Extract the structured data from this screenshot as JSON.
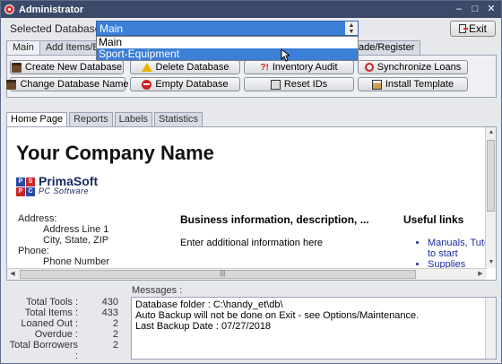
{
  "window": {
    "title": "Administrator",
    "controls": [
      "–",
      "□",
      "✕"
    ]
  },
  "database": {
    "label": "Selected Database :",
    "selected": "Main",
    "options": [
      "Main",
      "Sport-Equipment"
    ]
  },
  "exit_label": "Exit",
  "main_tabs": [
    "Main",
    "Add Items/B",
    "ade/Register"
  ],
  "toolbar": {
    "create_db": "Create New Database",
    "change_db_name": "Change Database Name",
    "delete_db": "Delete Database",
    "empty_db": "Empty Database",
    "inventory_audit": "Inventory Audit",
    "reset_ids": "Reset IDs",
    "sync_loans": "Synchronize Loans",
    "install_template": "Install Template"
  },
  "home_tabs": [
    "Home Page",
    "Reports",
    "Labels",
    "Statistics"
  ],
  "home_page": {
    "company_name": "Your Company Name",
    "logo_letters": [
      "P",
      "S",
      "P",
      "C"
    ],
    "logo_name": "PrimaSoft",
    "logo_sub": "PC Software",
    "address_label": "Address:",
    "address_line1": "Address Line 1",
    "address_line2": "City, State, ZIP",
    "phone_label": "Phone:",
    "phone_value": "Phone Number",
    "business_heading": "Business information, description, ...",
    "business_text": "Enter additional information here",
    "links_heading": "Useful links",
    "links": [
      "Manuals, Tuto",
      "to start",
      "Supplies"
    ]
  },
  "messages_label": "Messages :",
  "stats": [
    {
      "label": "Total Tools :",
      "value": "430"
    },
    {
      "label": "Total Items :",
      "value": "433"
    },
    {
      "label": "Loaned Out :",
      "value": "2"
    },
    {
      "label": "Overdue :",
      "value": "2"
    },
    {
      "label": "Total Borrowers :",
      "value": "2"
    }
  ],
  "messages": [
    "Database folder : C:\\handy_et\\db\\",
    "Auto Backup will not be done on Exit - see Options/Maintenance.",
    "Last Backup Date : 07/27/2018"
  ]
}
